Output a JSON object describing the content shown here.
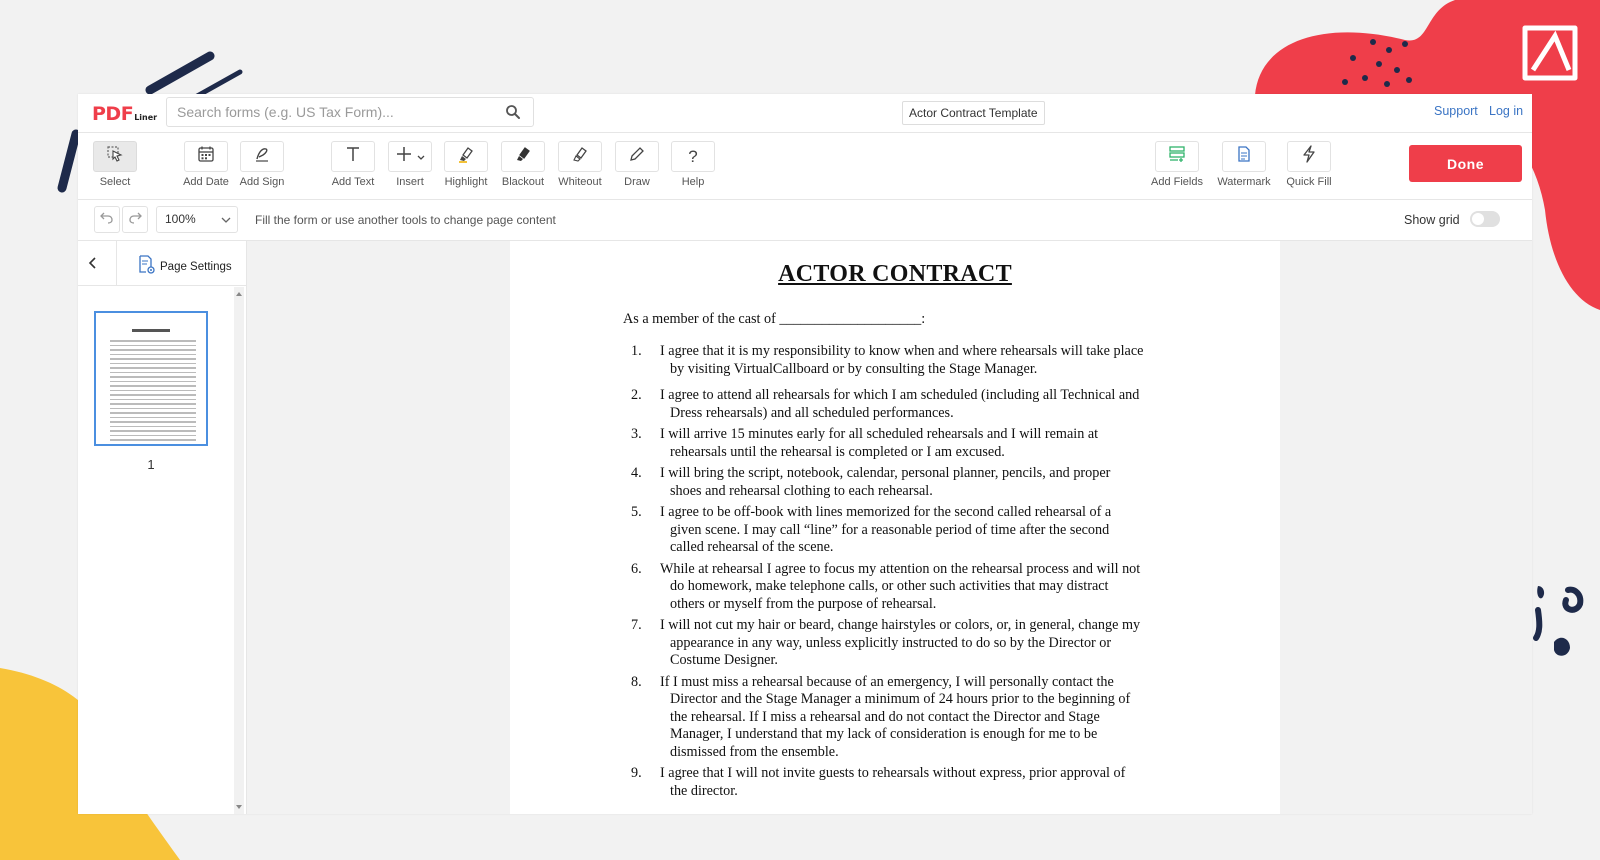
{
  "brand": {
    "logo_main": "PDF",
    "logo_sub": "Liner",
    "accent": "#ef3e4a"
  },
  "search": {
    "placeholder": "Search forms (e.g. US Tax Form)..."
  },
  "document_title": "Actor Contract Template",
  "nav": {
    "support": "Support",
    "login": "Log in"
  },
  "toolbar": {
    "select": "Select",
    "add_date": "Add Date",
    "add_sign": "Add Sign",
    "add_text": "Add Text",
    "insert": "Insert",
    "highlight": "Highlight",
    "blackout": "Blackout",
    "whiteout": "Whiteout",
    "draw": "Draw",
    "help": "Help",
    "add_fields": "Add Fields",
    "watermark": "Watermark",
    "quick_fill": "Quick Fill",
    "done": "Done"
  },
  "subbar": {
    "zoom": "100%",
    "hint": "Fill the form or use another tools to change page content",
    "show_grid": "Show grid"
  },
  "left_panel": {
    "page_settings": "Page Settings",
    "page_number": "1"
  },
  "page": {
    "title": "ACTOR CONTRACT",
    "intro": "As a member of the cast of ____________________:",
    "items": [
      {
        "num": "1.",
        "lines": [
          "I agree that it is my responsibility to know when and where rehearsals will take place",
          "by visiting VirtualCallboard or by consulting the Stage Manager."
        ]
      },
      {
        "num": "2.",
        "lines": [
          "I agree to attend all rehearsals for which I am scheduled (including all Technical and",
          "Dress rehearsals) and all scheduled performances."
        ]
      },
      {
        "num": "3.",
        "lines": [
          "I will arrive 15 minutes early for all scheduled rehearsals and I will remain at",
          "rehearsals until the rehearsal is completed or I am excused."
        ]
      },
      {
        "num": "4.",
        "lines": [
          "I will bring the script, notebook, calendar, personal planner, pencils, and proper",
          "shoes and rehearsal clothing to each rehearsal."
        ]
      },
      {
        "num": "5.",
        "lines": [
          "I agree to be off-book with lines memorized for the second called rehearsal of a",
          "given scene.  I may call “line” for a reasonable period of time after the second",
          "called rehearsal of the scene."
        ]
      },
      {
        "num": "6.",
        "lines": [
          "While at rehearsal I agree to focus my attention on the rehearsal process and will not",
          "do homework, make telephone calls, or other such activities that may distract",
          "others or myself from the purpose of rehearsal."
        ]
      },
      {
        "num": "7.",
        "lines": [
          "I will not cut my hair or beard, change hairstyles or colors, or, in general, change my",
          "appearance in any way, unless explicitly instructed to do so by the Director or",
          "Costume Designer."
        ]
      },
      {
        "num": "8.",
        "lines": [
          "If I must miss a rehearsal because of an emergency, I will personally contact the",
          "Director and the Stage Manager a minimum of 24 hours prior to the beginning of",
          "the rehearsal. If I miss a rehearsal and do not contact the Director and Stage",
          "Manager, I understand that my lack of consideration is enough for me to be",
          "dismissed from the ensemble."
        ]
      },
      {
        "num": "9.",
        "lines": [
          "I agree that I will not invite guests to rehearsals without express, prior approval of",
          "the director."
        ]
      }
    ]
  }
}
